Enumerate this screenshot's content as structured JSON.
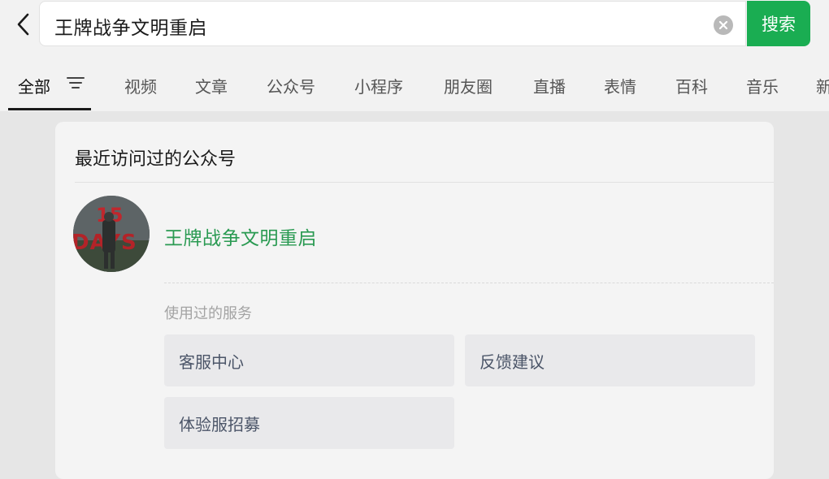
{
  "search": {
    "query": "王牌战争文明重启",
    "button_label": "搜索"
  },
  "tabs": [
    {
      "label": "全部",
      "active": true
    },
    {
      "label": "视频"
    },
    {
      "label": "文章"
    },
    {
      "label": "公众号"
    },
    {
      "label": "小程序"
    },
    {
      "label": "朋友圈"
    },
    {
      "label": "直播"
    },
    {
      "label": "表情"
    },
    {
      "label": "百科"
    },
    {
      "label": "音乐"
    },
    {
      "label": "新"
    }
  ],
  "recent": {
    "title": "最近访问过的公众号",
    "account_name": "王牌战争文明重启",
    "avatar_text": "15 DAYS",
    "services_label": "使用过的服务",
    "services": [
      "客服中心",
      "反馈建议",
      "体验服招募"
    ]
  },
  "colors": {
    "accent": "#1aad52",
    "account_name": "#2a9a52"
  }
}
